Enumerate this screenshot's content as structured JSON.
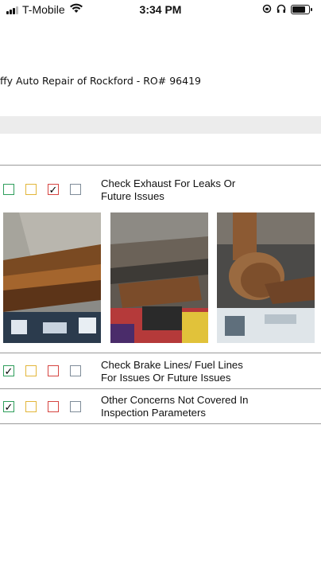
{
  "status_bar": {
    "carrier": "T-Mobile",
    "time": "3:34 PM"
  },
  "header": {
    "shop_title": "ffy Auto Repair of Rockford - RO# 96419"
  },
  "inspection_items": [
    {
      "label_lines": [
        "Check Exhaust For Leaks Or",
        "Future Issues"
      ],
      "checked": "red",
      "photos": [
        "exhaust-photo-1",
        "exhaust-photo-2",
        "exhaust-photo-3"
      ]
    },
    {
      "label_lines": [
        "Check Brake Lines/ Fuel Lines",
        "For Issues Or Future Issues"
      ],
      "checked": "green"
    },
    {
      "label_lines": [
        "Other Concerns Not Covered In",
        "Inspection Parameters"
      ],
      "checked": "green"
    }
  ],
  "check_mark": "✓",
  "colors": {
    "green": "#2e9e5b",
    "yellow": "#e2b63a",
    "red": "#d64541",
    "gray": "#7f8c99"
  }
}
